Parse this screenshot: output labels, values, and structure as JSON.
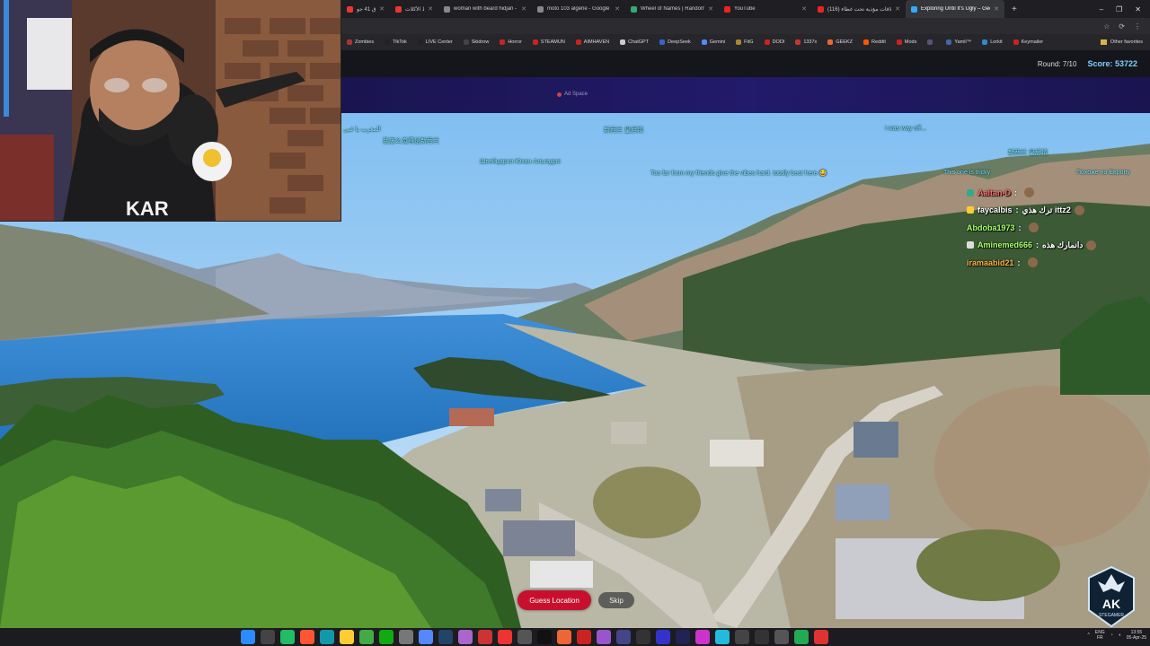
{
  "browser": {
    "tabs": [
      {
        "label": "دراق 41 جو",
        "color": "#e33",
        "active": false
      },
      {
        "label": "بابا ظط الأكلات",
        "color": "#e33",
        "active": false
      },
      {
        "label": "woman with beard hidjan - G",
        "color": "#888",
        "active": false
      },
      {
        "label": "moto 103 algerie - Google S",
        "color": "#888",
        "active": false
      },
      {
        "label": "Wheel of Names | Random n",
        "color": "#3a7",
        "active": false
      },
      {
        "label": "YouTube",
        "color": "#e22",
        "active": false
      },
      {
        "label": "علاقات مؤذية تحت غطاء (116)",
        "color": "#e22",
        "active": false
      },
      {
        "label": "Exploring Until It's Ugly – Geo",
        "color": "#3af",
        "active": true
      }
    ],
    "window_controls": [
      "–",
      "❐",
      "✕"
    ],
    "addr_icons": [
      "☆",
      "⟳",
      "⋮"
    ],
    "bookmarks": [
      {
        "label": "Zombies",
        "color": "#a33"
      },
      {
        "label": "TikTok",
        "color": "#222"
      },
      {
        "label": "LIVE Center",
        "color": "#222"
      },
      {
        "label": "Skidrow",
        "color": "#444"
      },
      {
        "label": "Horror",
        "color": "#c22"
      },
      {
        "label": "STEAMUN",
        "color": "#c22"
      },
      {
        "label": "AIMHAVEN",
        "color": "#c22"
      },
      {
        "label": "ChatGPT",
        "color": "#ccc"
      },
      {
        "label": "DeepSeek",
        "color": "#36c"
      },
      {
        "label": "Gemini",
        "color": "#58f"
      },
      {
        "label": "FitG",
        "color": "#a83"
      },
      {
        "label": "DODI",
        "color": "#c22"
      },
      {
        "label": "1337x",
        "color": "#c33"
      },
      {
        "label": "GEEKZ",
        "color": "#e63"
      },
      {
        "label": "Reddit",
        "color": "#f50"
      },
      {
        "label": "Mods",
        "color": "#c22"
      },
      {
        "label": "",
        "color": "#557"
      },
      {
        "label": "Yamli™",
        "color": "#46a"
      },
      {
        "label": "Lorkit",
        "color": "#38c"
      },
      {
        "label": "Keymailer",
        "color": "#c22"
      }
    ],
    "other_favorites": "Other favorites"
  },
  "game": {
    "round_label": "Round: 7/10",
    "score_label": "Score: 53722",
    "ad_label": "Ad Space",
    "guess_button": "Guess Location",
    "skip_button": "Skip"
  },
  "danmaku": [
    "المغرب يا غبي",
    "我怎么觉得是新西兰",
    "Швейцария Юхан Альгадия",
    "新西兰 皇后镇",
    "Too far from my friends give the vibes hard. totally best here 😂",
    "i was way off...",
    "新西兰 皇后镇",
    "Похоже на Европу",
    "This one is tricky"
  ],
  "chat": [
    {
      "user": "Aaitan-D",
      "text": "",
      "color": "#ff6a6a",
      "badge": "#3a8"
    },
    {
      "user": "faycalbis",
      "text": "ترك هذي ittz2",
      "color": "#ffffff",
      "badge": "#fc3"
    },
    {
      "user": "Abdoba1973",
      "text": "",
      "color": "#a6ff6a",
      "badge": ""
    },
    {
      "user": "Aminemed666",
      "text": "دانمارك هذه",
      "color": "#a6ff6a",
      "badge": "#ddd"
    },
    {
      "user": "iramaabid21",
      "text": "",
      "color": "#ffb04a",
      "badge": ""
    }
  ],
  "logo": {
    "text": "AK",
    "subtext": "STEGAMER"
  },
  "taskbar": {
    "icons": [
      {
        "name": "windows-start-icon",
        "color": "#2b8cff"
      },
      {
        "name": "search-icon",
        "color": "#444"
      },
      {
        "name": "browser-icon",
        "color": "#2b6"
      },
      {
        "name": "brave-icon",
        "color": "#f53"
      },
      {
        "name": "edge-icon",
        "color": "#19a"
      },
      {
        "name": "explorer-icon",
        "color": "#fc3"
      },
      {
        "name": "app-icon",
        "color": "#4a4"
      },
      {
        "name": "xbox-icon",
        "color": "#1a1"
      },
      {
        "name": "app-icon",
        "color": "#777"
      },
      {
        "name": "discord-icon",
        "color": "#58f"
      },
      {
        "name": "steam-icon",
        "color": "#246"
      },
      {
        "name": "app-icon",
        "color": "#a6c"
      },
      {
        "name": "app-icon",
        "color": "#c33"
      },
      {
        "name": "app-icon",
        "color": "#e33"
      },
      {
        "name": "app-icon",
        "color": "#555"
      },
      {
        "name": "tiktok-icon",
        "color": "#111"
      },
      {
        "name": "app-icon",
        "color": "#e63"
      },
      {
        "name": "app-icon",
        "color": "#c22"
      },
      {
        "name": "app-icon",
        "color": "#95c"
      },
      {
        "name": "app-icon",
        "color": "#448"
      },
      {
        "name": "app-icon",
        "color": "#333"
      },
      {
        "name": "app-icon",
        "color": "#33c"
      },
      {
        "name": "app-icon",
        "color": "#225"
      },
      {
        "name": "app-icon",
        "color": "#c3c"
      },
      {
        "name": "app-icon",
        "color": "#2bd"
      },
      {
        "name": "app-icon",
        "color": "#444"
      },
      {
        "name": "app-icon",
        "color": "#333"
      },
      {
        "name": "app-icon",
        "color": "#555"
      },
      {
        "name": "app-icon",
        "color": "#2a5"
      },
      {
        "name": "app-icon",
        "color": "#d33"
      }
    ],
    "lang_top": "ENG",
    "lang_bottom": "FR",
    "time": "13:55",
    "date": "05-Apr-25"
  }
}
